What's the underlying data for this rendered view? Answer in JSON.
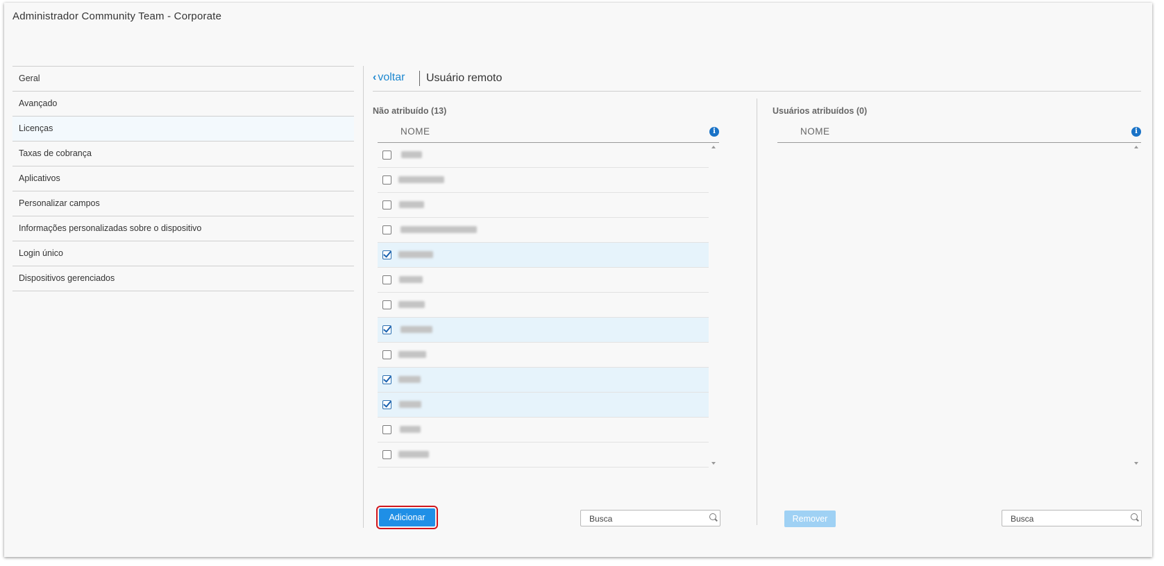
{
  "window": {
    "title": "Administrador Community Team - Corporate"
  },
  "sidebar": {
    "items": [
      {
        "label": "Geral"
      },
      {
        "label": "Avançado"
      },
      {
        "label": "Licenças",
        "active": true
      },
      {
        "label": "Taxas de cobrança"
      },
      {
        "label": "Aplicativos"
      },
      {
        "label": "Personalizar campos"
      },
      {
        "label": "Informações personalizadas sobre o dispositivo"
      },
      {
        "label": "Login único"
      },
      {
        "label": "Dispositivos gerenciados"
      }
    ]
  },
  "header": {
    "back_label": "voltar",
    "back_icon": "chevron-left-icon",
    "title": "Usuário remoto"
  },
  "unassigned": {
    "title": "Não atribuído (13)",
    "column": "NOME",
    "rows": [
      {
        "checked": false
      },
      {
        "checked": false
      },
      {
        "checked": false
      },
      {
        "checked": false
      },
      {
        "checked": true
      },
      {
        "checked": false
      },
      {
        "checked": false
      },
      {
        "checked": true
      },
      {
        "checked": false
      },
      {
        "checked": true
      },
      {
        "checked": true
      },
      {
        "checked": false
      },
      {
        "checked": false
      }
    ],
    "add_button": "Adicionar",
    "search_placeholder": "Busca"
  },
  "assigned": {
    "title": "Usuários atribuídos (0)",
    "column": "NOME",
    "remove_button": "Remover",
    "search_placeholder": "Busca"
  },
  "colors": {
    "accent": "#1f8fe6",
    "highlight": "#d0151c",
    "checked_row": "#e6f3fb"
  }
}
